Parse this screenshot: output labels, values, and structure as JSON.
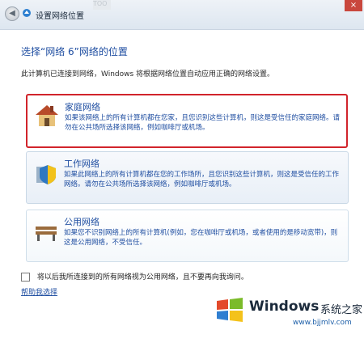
{
  "window": {
    "title": "设置网络位置",
    "faded_tab": "TOO",
    "close_label": "×"
  },
  "heading": "选择“网络 6”网络的位置",
  "description": "此计算机已连接到网络，Windows 将根据网络位置自动应用正确的网络设置。",
  "options": [
    {
      "title": "家庭网络",
      "desc": "如果该网络上的所有计算机都在您家，且您识别这些计算机，则这是受信任的家庭网络。请勿在公共场所选择该网络，例如咖啡厅或机场。",
      "selected": true
    },
    {
      "title": "工作网络",
      "desc": "如果此网络上的所有计算机都在您的工作场所，且您识别这些计算机，则这是受信任的工作网络。请勿在公共场所选择该网络，例如咖啡厅或机场。",
      "selected": false
    },
    {
      "title": "公用网络",
      "desc": "如果您不识别网络上的所有计算机(例如，您在咖啡厅或机场，或者使用的是移动宽带)，则这是公用网络，不受信任。",
      "selected": false
    }
  ],
  "checkbox_label": "将以后我所连接到的所有网络视为公用网络，且不要再向我询问。",
  "help_link": "帮助我选择",
  "watermark": {
    "brand": "Windows",
    "cn": "系统之家",
    "url": "www.bjjmlv.com"
  },
  "colors": {
    "link_blue": "#1f4ea1",
    "selected_border": "#d1242b"
  }
}
